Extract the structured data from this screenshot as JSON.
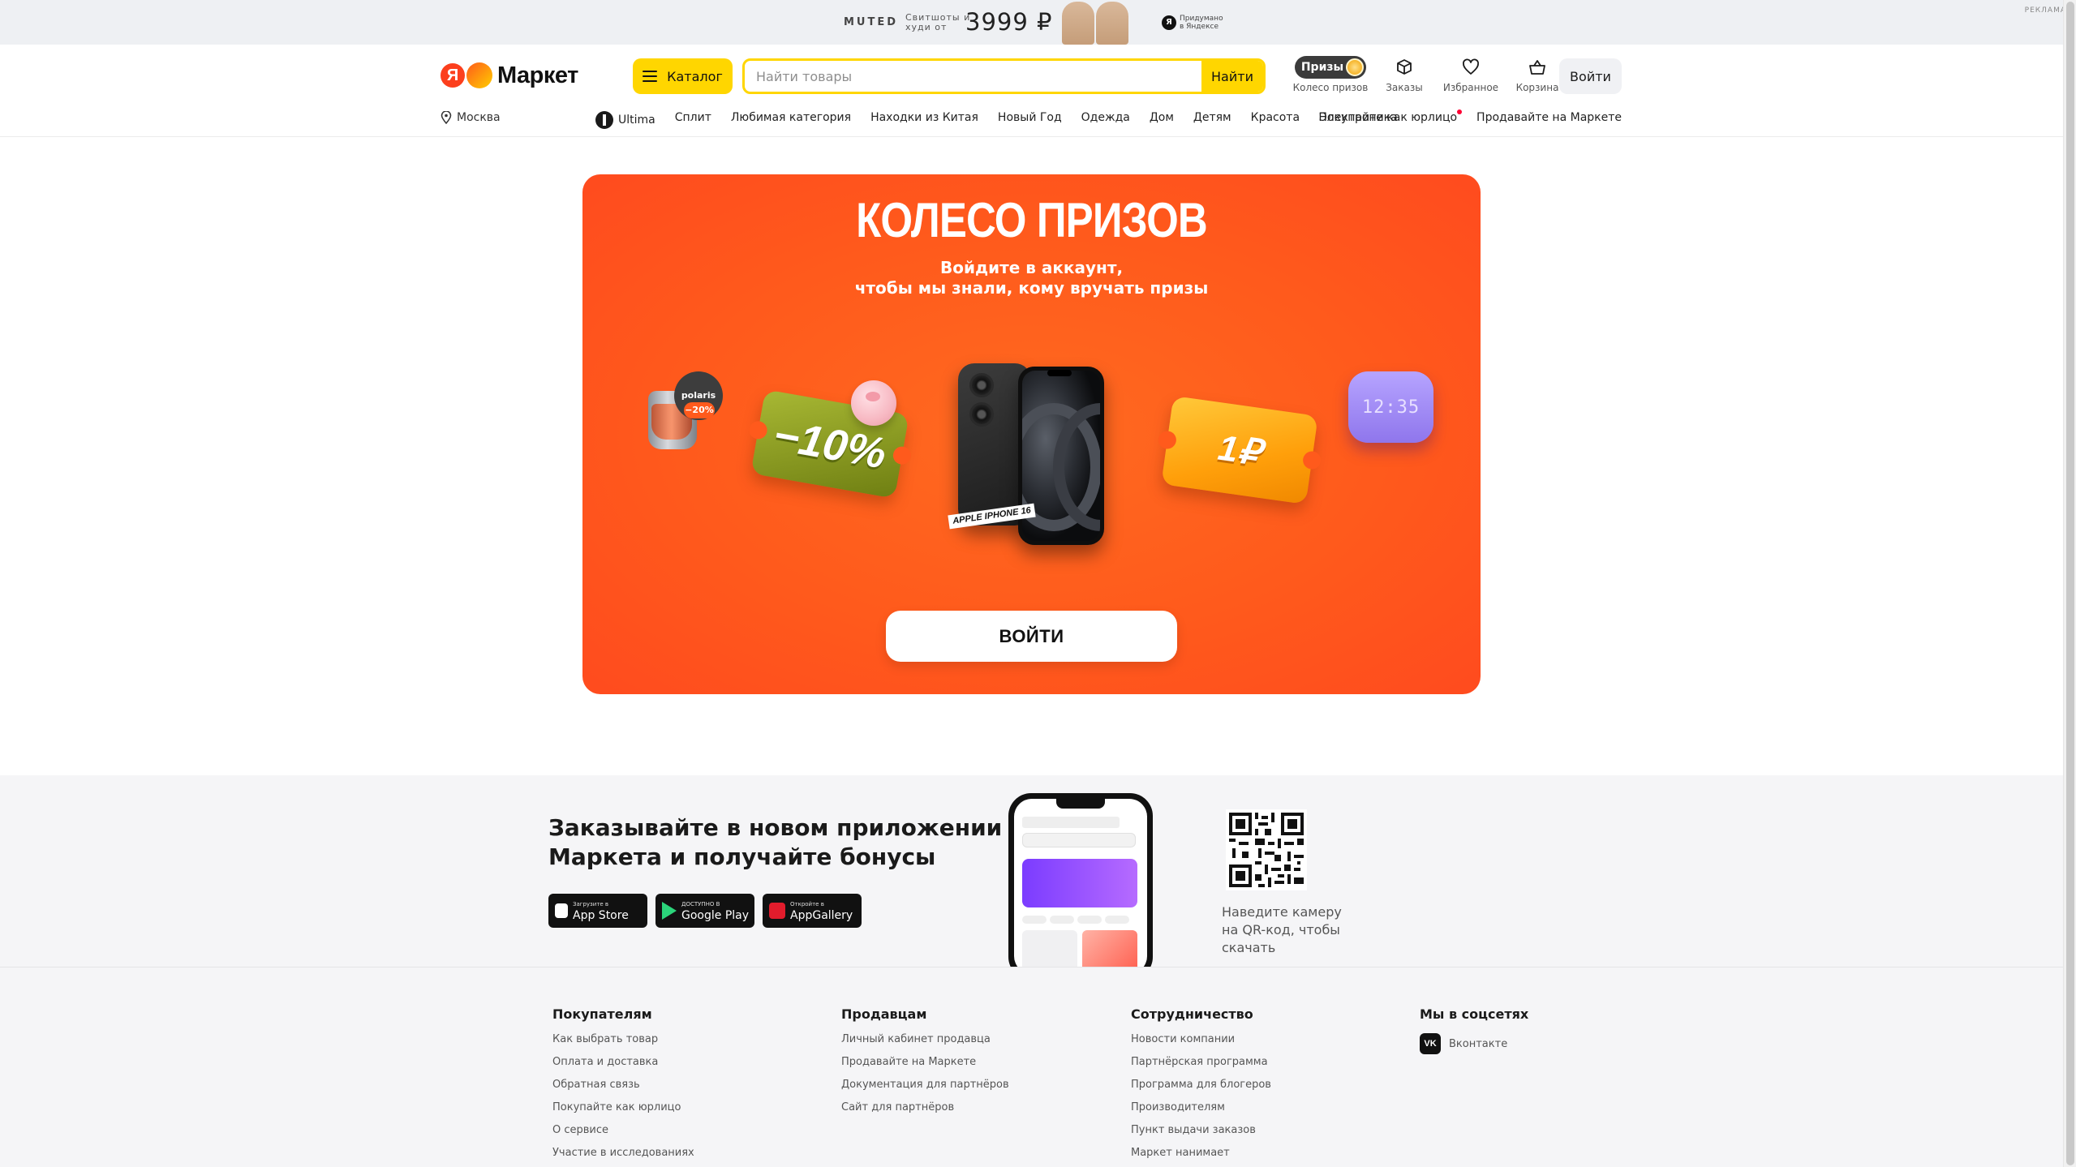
{
  "ad": {
    "brand": "MUTED",
    "tagline": "Свитшоты и худи от",
    "price": "3999 ₽",
    "yandex_note": "Придумано в Яндексе",
    "ya_letter": "Я",
    "label": "РЕКЛАМА"
  },
  "header": {
    "logo_letter": "Я",
    "logo_word": "Маркет",
    "catalog_label": "Каталог",
    "search_placeholder": "Найти товары",
    "search_button": "Найти",
    "prizes_pill": "Призы",
    "prizes_label": "Колесо призов",
    "orders_label": "Заказы",
    "favorites_label": "Избранное",
    "cart_label": "Корзина",
    "login_label": "Войти"
  },
  "nav": {
    "city": "Москва",
    "links": [
      "Ultima",
      "Сплит",
      "Любимая категория",
      "Находки из Китая",
      "Новый Год",
      "Одежда",
      "Дом",
      "Детям",
      "Красота",
      "Электроника"
    ],
    "right": [
      "Покупайте как юрлицо",
      "Продавайте на Маркете"
    ]
  },
  "wheel": {
    "title": "КОЛЕСО ПРИЗОВ",
    "subtitle_line1": "Войдите в аккаунт,",
    "subtitle_line2": "чтобы мы знали, кому вручать призы",
    "kettle_brand": "polaris",
    "kettle_discount": "−20%",
    "ticket_discount": "−10%",
    "phone_tag": "APPLE IPHONE 16",
    "ticket_ruble": "1₽",
    "speaker_time": "12:35",
    "button": "ВОЙТИ"
  },
  "app_promo": {
    "heading_line1": "Заказывайте в новом приложении",
    "heading_line2": "Маркета и получайте бонусы",
    "stores": [
      {
        "small": "Загрузите в",
        "name": "App Store",
        "icon": "apple-icon"
      },
      {
        "small": "ДОСТУПНО В",
        "name": "Google Play",
        "icon": "google-play-icon"
      },
      {
        "small": "Откройте в",
        "name": "AppGallery",
        "icon": "huawei-icon"
      }
    ],
    "qr_text": "Наведите камеру на QR-код, чтобы скачать"
  },
  "footer": {
    "col1": {
      "title": "Покупателям",
      "links": [
        "Как выбрать товар",
        "Оплата и доставка",
        "Обратная связь",
        "Покупайте как юрлицо",
        "О сервисе",
        "Участие в исследованиях"
      ]
    },
    "col2": {
      "title": "Продавцам",
      "links": [
        "Личный кабинет продавца",
        "Продавайте на Маркете",
        "Документация для партнёров",
        "Сайт для партнёров"
      ]
    },
    "col3": {
      "title": "Сотрудничество",
      "links": [
        "Новости компании",
        "Партнёрская программа",
        "Программа для блогеров",
        "Производителям",
        "Пункт выдачи заказов",
        "Маркет нанимает"
      ]
    },
    "col4": {
      "title": "Мы в соцсетях",
      "vk_icon": "VK",
      "vk_label": "Вконтакте"
    }
  },
  "colors": {
    "brand_yellow": "#ffd600",
    "wheel_orange": "#ff5a1c",
    "ya_red": "#fc3f1d"
  }
}
